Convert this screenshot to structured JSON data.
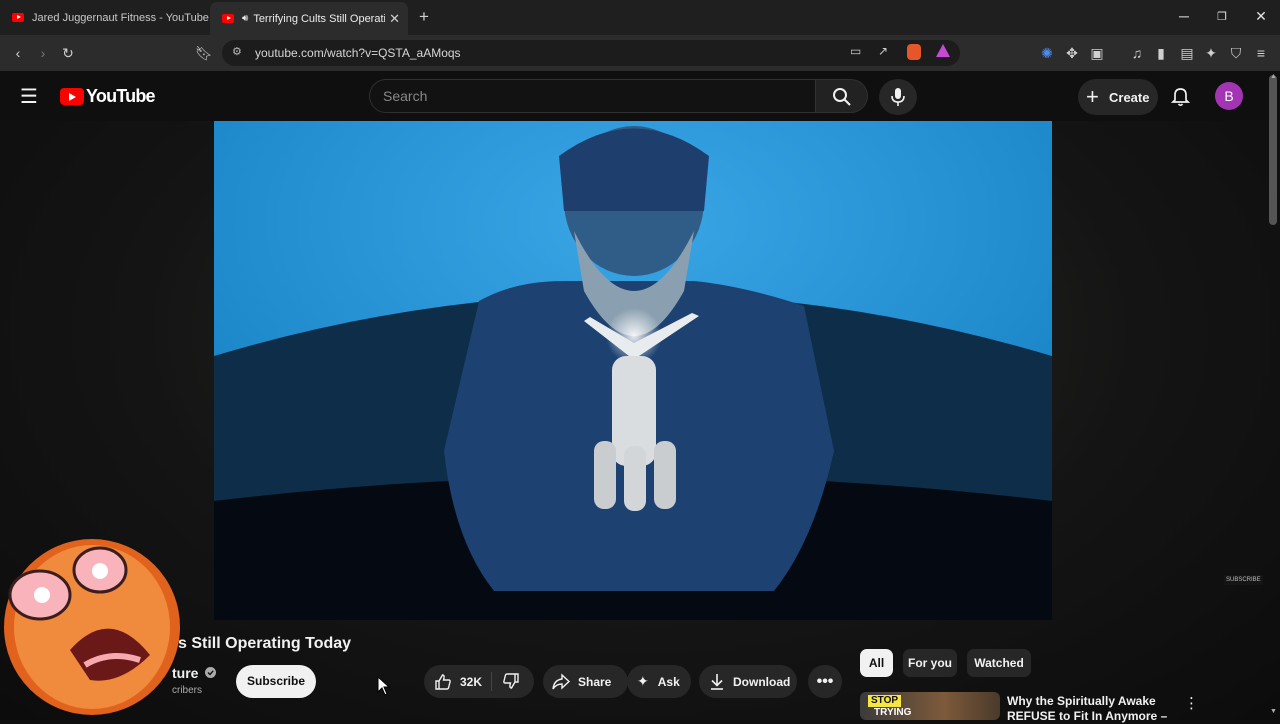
{
  "browser": {
    "tabs": [
      {
        "title": "Jared Juggernaut Fitness - YouTube",
        "active": false
      },
      {
        "title": "Terrifying Cults Still Operating",
        "active": true
      }
    ],
    "url": "youtube.com/watch?v=QSTA_aAMoqs"
  },
  "youtube": {
    "logo": "YouTube",
    "search_placeholder": "Search",
    "create_label": "Create",
    "avatar_letter": "B"
  },
  "video": {
    "title": "s Still Operating Today",
    "channel": "ture",
    "subscribers": "cribers",
    "subscribe_label": "Subscribe",
    "like_count": "32K",
    "share_label": "Share",
    "ask_label": "Ask",
    "download_label": "Download",
    "watermark": "SUBSCRIBE"
  },
  "sidebar": {
    "chips": [
      {
        "label": "All",
        "active": true
      },
      {
        "label": "For you",
        "active": false
      },
      {
        "label": "Watched",
        "active": false
      }
    ],
    "recommendation": {
      "title": "Why the Spiritually Awake REFUSE to Fit In Anymore –",
      "thumb_text_1": "STOP",
      "thumb_text_2": "TRYING"
    }
  },
  "colors": {
    "youtube_red": "#ff0000",
    "avatar_purple": "#a335b4",
    "background": "#0f0f0f"
  }
}
